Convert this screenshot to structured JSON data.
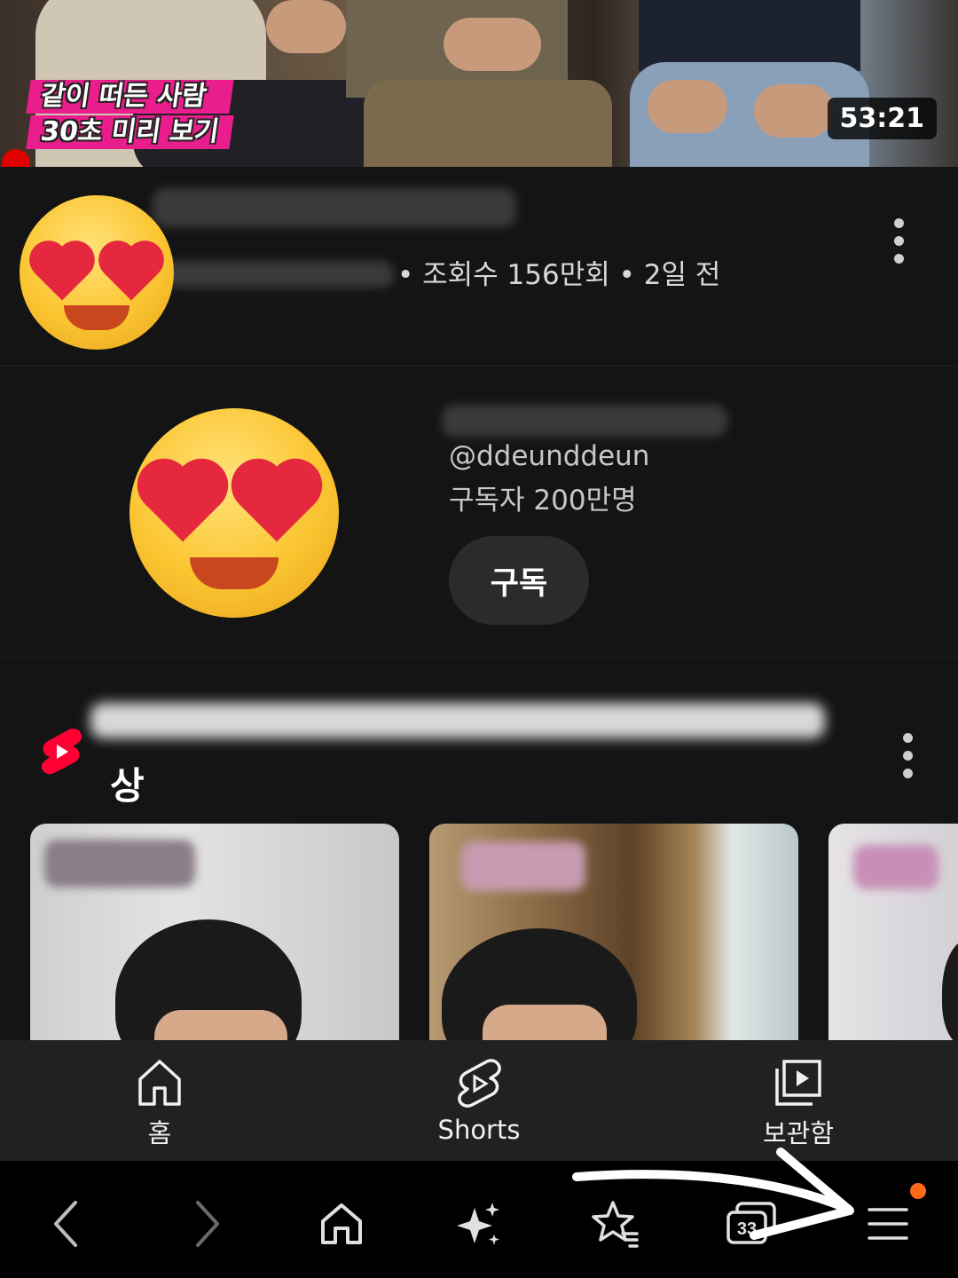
{
  "video": {
    "caption_lines": [
      "같이 떠든 사람",
      "30초 미리 보기"
    ],
    "duration": "53:21",
    "meta": "• 조회수 156만회 • 2일 전"
  },
  "channel": {
    "handle": "@ddeunddeun",
    "subscribers": "구독자 200만명",
    "subscribe_label": "구독"
  },
  "shorts_shelf": {
    "title_tail": "상"
  },
  "yt_nav": {
    "items": [
      {
        "label": "홈",
        "icon": "home-icon"
      },
      {
        "label": "Shorts",
        "icon": "shorts-icon"
      },
      {
        "label": "보관함",
        "icon": "library-icon"
      }
    ]
  },
  "browser_bar": {
    "tab_count": "33",
    "icons": [
      "back-icon",
      "forward-icon",
      "home-icon",
      "sparkle-icon",
      "bookmark-star-icon",
      "tabs-icon",
      "menu-icon"
    ]
  },
  "colors": {
    "background": "#141414",
    "caption_pink": "#e91e8c",
    "shorts_red": "#ff0033",
    "notification_orange": "#ff6a1a"
  }
}
